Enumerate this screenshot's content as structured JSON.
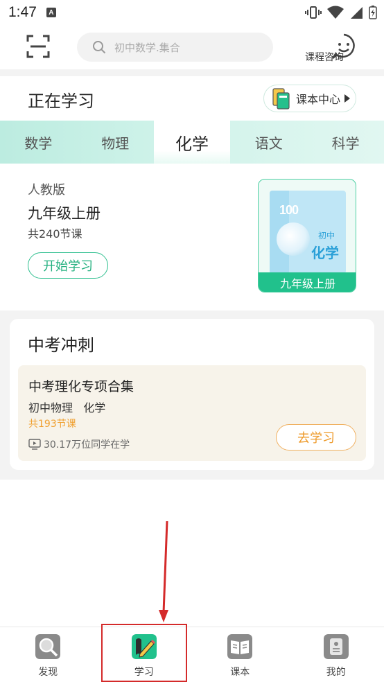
{
  "status_bar": {
    "time": "1:47",
    "notification_icon": "A"
  },
  "top_bar": {
    "scan_icon": "scan-icon",
    "search_placeholder": "初中数学.集合",
    "consult_label": "课程咨询"
  },
  "studying": {
    "title": "正在学习",
    "textbook_center_label": "课本中心"
  },
  "subject_tabs": [
    {
      "label": "数学",
      "active": false
    },
    {
      "label": "物理",
      "active": false
    },
    {
      "label": "化学",
      "active": true
    },
    {
      "label": "语文",
      "active": false
    },
    {
      "label": "科学",
      "active": false
    }
  ],
  "course": {
    "edition": "人教版",
    "grade": "九年级上册",
    "lesson_count": "共240节课",
    "start_label": "开始学习",
    "cover": {
      "logo": "100",
      "level": "初中",
      "subject": "化学",
      "band": "九年级上册"
    }
  },
  "exam_sprint": {
    "title": "中考冲刺",
    "item": {
      "title": "中考理化专项合集",
      "subjects": "初中物理   化学",
      "lesson_count": "共193节课",
      "learners": "30.17万位同学在学",
      "go_label": "去学习"
    }
  },
  "bottom_nav": [
    {
      "label": "发现",
      "icon": "magnifier-icon"
    },
    {
      "label": "学习",
      "icon": "pencil-book-icon",
      "active": true
    },
    {
      "label": "课本",
      "icon": "open-book-icon"
    },
    {
      "label": "我的",
      "icon": "profile-icon"
    }
  ],
  "colors": {
    "accent": "#23b07f",
    "tab_gradient_start": "#bcece0",
    "orange": "#ee9a2a",
    "annotation_red": "#d42a2a"
  }
}
